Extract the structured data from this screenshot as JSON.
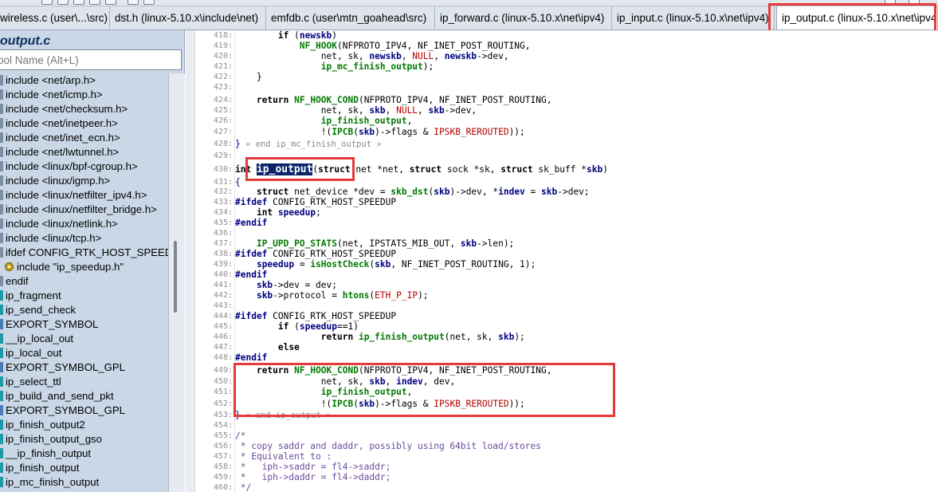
{
  "window": {
    "tabs": [
      {
        "label": "wireless.c (user\\...\\src)",
        "active": false
      },
      {
        "label": "dst.h (linux-5.10.x\\include\\net)",
        "active": false
      },
      {
        "label": "emfdb.c (user\\mtn_goahead\\src)",
        "active": false
      },
      {
        "label": "ip_forward.c (linux-5.10.x\\net\\ipv4)",
        "active": false
      },
      {
        "label": "ip_input.c (linux-5.10.x\\net\\ipv4)",
        "active": false
      },
      {
        "label": "ip_output.c (linux-5.10.x\\net\\ipv4",
        "active": true
      }
    ]
  },
  "sidebar": {
    "file_title": "output.c",
    "search_placeholder": "bol Name (Alt+L)",
    "symbols": [
      {
        "label": "include <net/arp.h>",
        "kind": "inc"
      },
      {
        "label": "include <net/icmp.h>",
        "kind": "inc"
      },
      {
        "label": "include <net/checksum.h>",
        "kind": "inc"
      },
      {
        "label": "include <net/inetpeer.h>",
        "kind": "inc"
      },
      {
        "label": "include <net/inet_ecn.h>",
        "kind": "inc"
      },
      {
        "label": "include <net/lwtunnel.h>",
        "kind": "inc"
      },
      {
        "label": "include <linux/bpf-cgroup.h>",
        "kind": "inc"
      },
      {
        "label": "include <linux/igmp.h>",
        "kind": "inc"
      },
      {
        "label": "include <linux/netfilter_ipv4.h>",
        "kind": "inc"
      },
      {
        "label": "include <linux/netfilter_bridge.h>",
        "kind": "inc"
      },
      {
        "label": "include <linux/netlink.h>",
        "kind": "inc"
      },
      {
        "label": "include <linux/tcp.h>",
        "kind": "inc"
      },
      {
        "label": "ifdef CONFIG_RTK_HOST_SPEEDUP",
        "kind": "inc"
      },
      {
        "label": "include \"ip_speedup.h\"",
        "kind": "nested"
      },
      {
        "label": "endif",
        "kind": "inc"
      },
      {
        "label": "ip_fragment",
        "kind": "fn"
      },
      {
        "label": "ip_send_check",
        "kind": "fn"
      },
      {
        "label": "EXPORT_SYMBOL",
        "kind": "def"
      },
      {
        "label": "__ip_local_out",
        "kind": "fn"
      },
      {
        "label": "ip_local_out",
        "kind": "fn"
      },
      {
        "label": "EXPORT_SYMBOL_GPL",
        "kind": "def"
      },
      {
        "label": "ip_select_ttl",
        "kind": "fn"
      },
      {
        "label": "ip_build_and_send_pkt",
        "kind": "fn"
      },
      {
        "label": "EXPORT_SYMBOL_GPL",
        "kind": "def"
      },
      {
        "label": "ip_finish_output2",
        "kind": "fn"
      },
      {
        "label": "ip_finish_output_gso",
        "kind": "fn"
      },
      {
        "label": "__ip_finish_output",
        "kind": "fn"
      },
      {
        "label": "ip_finish_output",
        "kind": "fn"
      },
      {
        "label": "ip_mc_finish_output",
        "kind": "fn"
      }
    ]
  },
  "editor": {
    "line_numbers": [
      "418:",
      "419:",
      "420:",
      "421:",
      "422:",
      "423:",
      "424:",
      "425:",
      "426:",
      "427:",
      "428:",
      "429:",
      "430:",
      "431:",
      "432:",
      "433:",
      "434:",
      "435:",
      "436:",
      "437:",
      "438:",
      "439:",
      "440:",
      "441:",
      "442:",
      "443:",
      "444:",
      "445:",
      "446:",
      "447:",
      "448:",
      "449:",
      "450:",
      "451:",
      "452:",
      "453:",
      "454:",
      "455:",
      "456:",
      "457:",
      "458:",
      "459:",
      "460:"
    ],
    "code": {
      "l418": "        if (newskb)",
      "l419": "            NF_HOOK(NFPROTO_IPV4, NF_INET_POST_ROUTING,",
      "l420": "                net, sk, newskb, NULL, newskb->dev,",
      "l421": "                ip_mc_finish_output);",
      "l422": "    }",
      "l424": "    return NF_HOOK_COND(NFPROTO_IPV4, NF_INET_POST_ROUTING,",
      "l425": "                net, sk, skb, NULL, skb->dev,",
      "l426": "                ip_finish_output,",
      "l427": "                !(IPCB(skb)->flags & IPSKB_REROUTED));",
      "l428_brace": "}",
      "l428_comment": " « end ip_mc_finish_output »",
      "l430_pre": "int ",
      "l430_fn": "ip_output",
      "l430_post": "(struct net *net, struct sock *sk, struct sk_buff *skb)",
      "l431": "{",
      "l432": "    struct net_device *dev = skb_dst(skb)->dev, *indev = skb->dev;",
      "l433": "#ifdef CONFIG_RTK_HOST_SPEEDUP",
      "l434": "    int speedup;",
      "l435": "#endif",
      "l437": "    IP_UPD_PO_STATS(net, IPSTATS_MIB_OUT, skb->len);",
      "l438": "#ifdef CONFIG_RTK_HOST_SPEEDUP",
      "l439": "    speedup = isHostCheck(skb, NF_INET_POST_ROUTING, 1);",
      "l440": "#endif",
      "l441": "    skb->dev = dev;",
      "l442": "    skb->protocol = htons(ETH_P_IP);",
      "l444": "#ifdef CONFIG_RTK_HOST_SPEEDUP",
      "l445": "        if (speedup==1)",
      "l446": "                return ip_finish_output(net, sk, skb);",
      "l447": "        else",
      "l448": "#endif",
      "l449": "    return NF_HOOK_COND(NFPROTO_IPV4, NF_INET_POST_ROUTING,",
      "l450": "                net, sk, skb, indev, dev,",
      "l451": "                ip_finish_output,",
      "l452": "                !(IPCB(skb)->flags & IPSKB_REROUTED));",
      "l453_brace": "}",
      "l453_comment": " « end ip_output »",
      "l455": "/*",
      "l456": " * copy saddr and daddr, possibly using 64bit load/stores",
      "l457": " * Equivalent to :",
      "l458": " *   iph->saddr = fl4->saddr;",
      "l459": " *   iph->daddr = fl4->daddr;",
      "l460": " */"
    }
  },
  "colors": {
    "annotation_red": "#e53a3a",
    "selection_bg": "#0a246a",
    "sidebar_bg": "#c9d7e6"
  }
}
